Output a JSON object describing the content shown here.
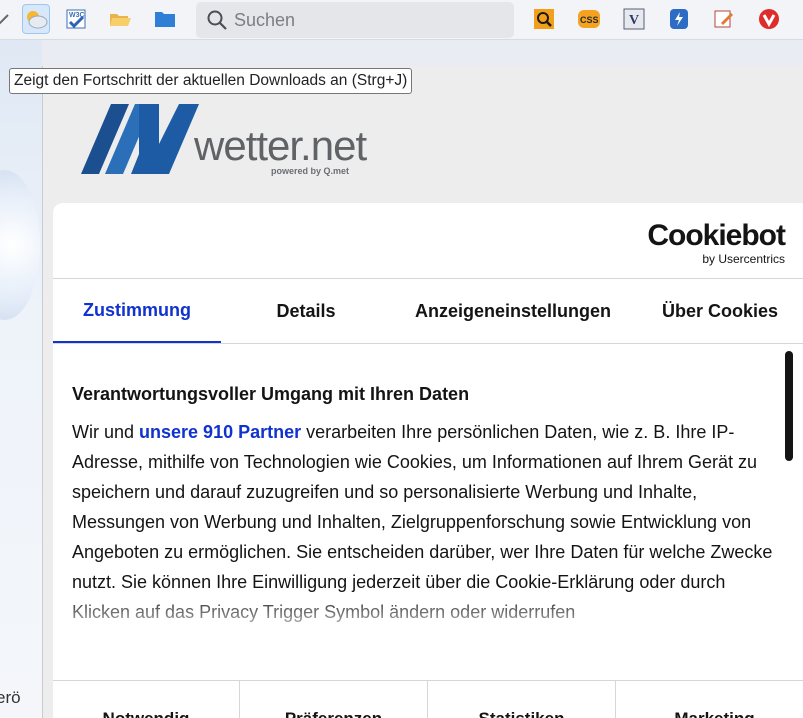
{
  "toolbar": {
    "search_placeholder": "Suchen"
  },
  "tooltip": {
    "text": "Zeigt den Fortschritt der aktuellen Downloads an (Strg+J)"
  },
  "left_edge_text": "erö",
  "logo": {
    "word": "wetter.net",
    "powered": "powered by Q.met"
  },
  "dialog": {
    "brand_name": "Cookiebot",
    "brand_sub": "by Usercentrics",
    "tabs": [
      "Zustimmung",
      "Details",
      "Anzeigeneinstellungen",
      "Über Cookies"
    ],
    "heading": "Verantwortungsvoller Umgang mit Ihren Daten",
    "para_prefix": "Wir und ",
    "partner_link": "unsere 910 Partner",
    "para_rest": " verarbeiten Ihre persönlichen Daten, wie z. B. Ihre IP-Adresse, mithilfe von Technologien wie Cookies, um Informationen auf Ihrem Gerät zu speichern und darauf zuzugreifen und so personalisierte Werbung und Inhalte, Messungen von Werbung und Inhalten, Zielgruppenforschung sowie Entwicklung von Angeboten zu ermöglichen. Sie entscheiden darüber, wer Ihre Daten für welche Zwecke nutzt. Sie können Ihre Einwilligung jederzeit über die Cookie-Erklärung oder durch Klicken auf das Privacy Trigger Symbol ändern oder widerrufen",
    "categories": [
      "Notwendig",
      "Präferenzen",
      "Statistiken",
      "Marketing"
    ]
  }
}
